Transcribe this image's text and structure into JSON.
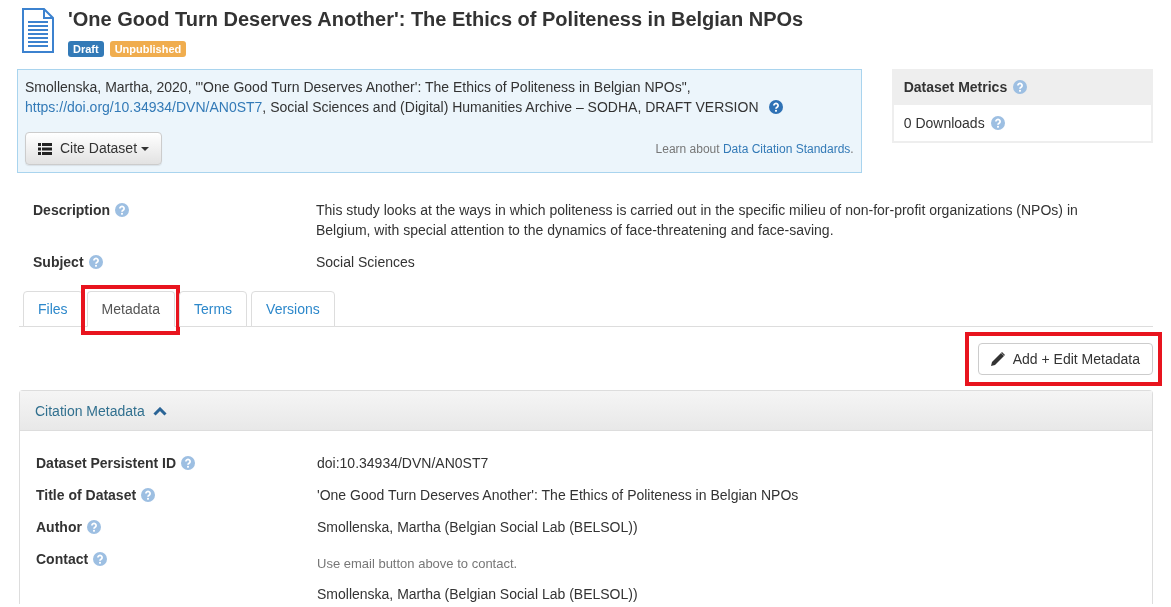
{
  "dataset": {
    "title": "'One Good Turn Deserves Another': The Ethics of Politeness in Belgian NPOs",
    "badges": [
      {
        "label": "Draft",
        "color": "#337ab7"
      },
      {
        "label": "Unpublished",
        "color": "#f0ad4e"
      }
    ]
  },
  "citation": {
    "text_before": "Smollenska, Martha, 2020, \"'One Good Turn Deserves Another': The Ethics of Politeness in Belgian NPOs\", ",
    "link": "https://doi.org/10.34934/DVN/AN0ST7",
    "text_after": ", Social Sciences and (Digital) Humanities Archive – SODHA, DRAFT VERSION",
    "cite_button": "Cite Dataset",
    "standards_note": {
      "text": "Learn about ",
      "link": "Data Citation Standards",
      "after": "."
    }
  },
  "metrics": {
    "title": "Dataset Metrics",
    "downloads": "0 Downloads"
  },
  "summary": [
    {
      "label": "Description",
      "value": "This study looks at the ways in which politeness is carried out in the specific milieu of non-for-profit organizations (NPOs) in Belgium, with special attention to the dynamics of face-threatening and face-saving."
    },
    {
      "label": "Subject",
      "value": "Social Sciences"
    }
  ],
  "tabs": [
    {
      "label": "Files",
      "selected": false,
      "highlighted": false
    },
    {
      "label": "Metadata",
      "selected": true,
      "highlighted": true
    },
    {
      "label": "Terms",
      "selected": false,
      "highlighted": false
    },
    {
      "label": "Versions",
      "selected": false,
      "highlighted": false
    }
  ],
  "edit_button": {
    "label": "Add + Edit Metadata",
    "highlighted": true
  },
  "citation_metadata": {
    "title": "Citation Metadata",
    "expanded": true,
    "fields": [
      {
        "label": "Dataset Persistent ID",
        "values": [
          {
            "kind": "text",
            "text": "doi:10.34934/DVN/AN0ST7"
          }
        ]
      },
      {
        "label": "Title of Dataset",
        "values": [
          {
            "kind": "text",
            "text": "'One Good Turn Deserves Another': The Ethics of Politeness in Belgian NPOs"
          }
        ]
      },
      {
        "label": "Author",
        "values": [
          {
            "kind": "text",
            "text": "Smollenska, Martha (Belgian Social Lab (BELSOL))"
          }
        ]
      },
      {
        "label": "Contact",
        "values": [
          {
            "kind": "note",
            "text": "Use email button above to contact."
          },
          {
            "kind": "text",
            "text": "Smollenska, Martha (Belgian Social Lab (BELSOL))"
          }
        ]
      }
    ]
  }
}
